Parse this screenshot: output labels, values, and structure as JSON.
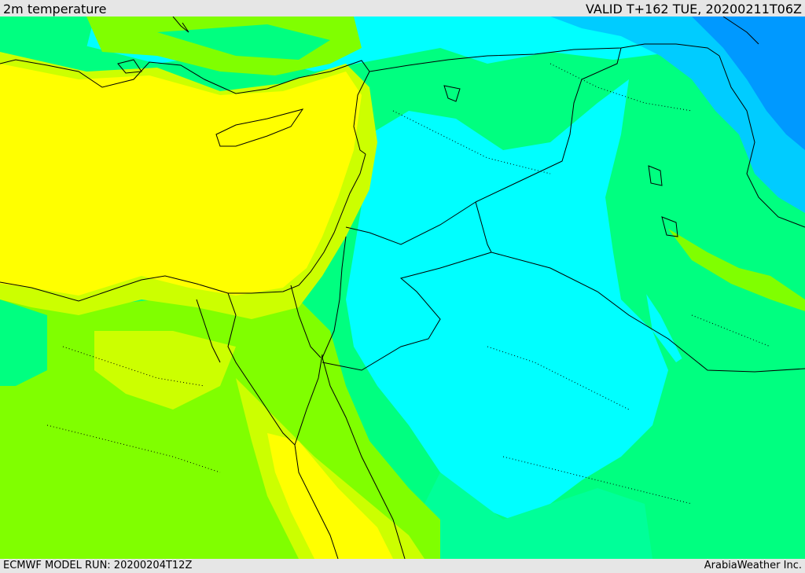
{
  "header": {
    "title": "2m temperature",
    "valid": "VALID T+162 TUE, 20200211T06Z"
  },
  "footer": {
    "model_run": "ECMWF MODEL RUN: 20200204T12Z",
    "credit": "ArabiaWeather Inc."
  },
  "colors": {
    "warm_yellow": "#ffff00",
    "yellow_green": "#ccff00",
    "lime": "#80ff00",
    "green": "#00ff80",
    "spring_green": "#00ff99",
    "cyan": "#00ffff",
    "sky": "#00ccff",
    "blue": "#0099ff",
    "boundaries": "#000000"
  }
}
